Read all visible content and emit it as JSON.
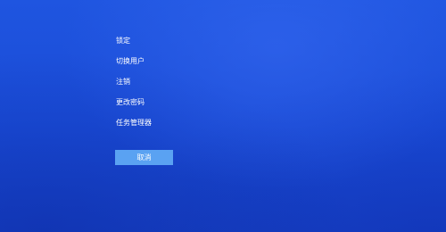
{
  "menu": {
    "items": [
      {
        "label": "锁定"
      },
      {
        "label": "切换用户"
      },
      {
        "label": "注销"
      },
      {
        "label": "更改密码"
      },
      {
        "label": "任务管理器"
      }
    ]
  },
  "cancel_button": {
    "label": "取消"
  },
  "colors": {
    "background": "#1a4bd6",
    "button": "#5aa2f2",
    "text": "#ffffff"
  }
}
